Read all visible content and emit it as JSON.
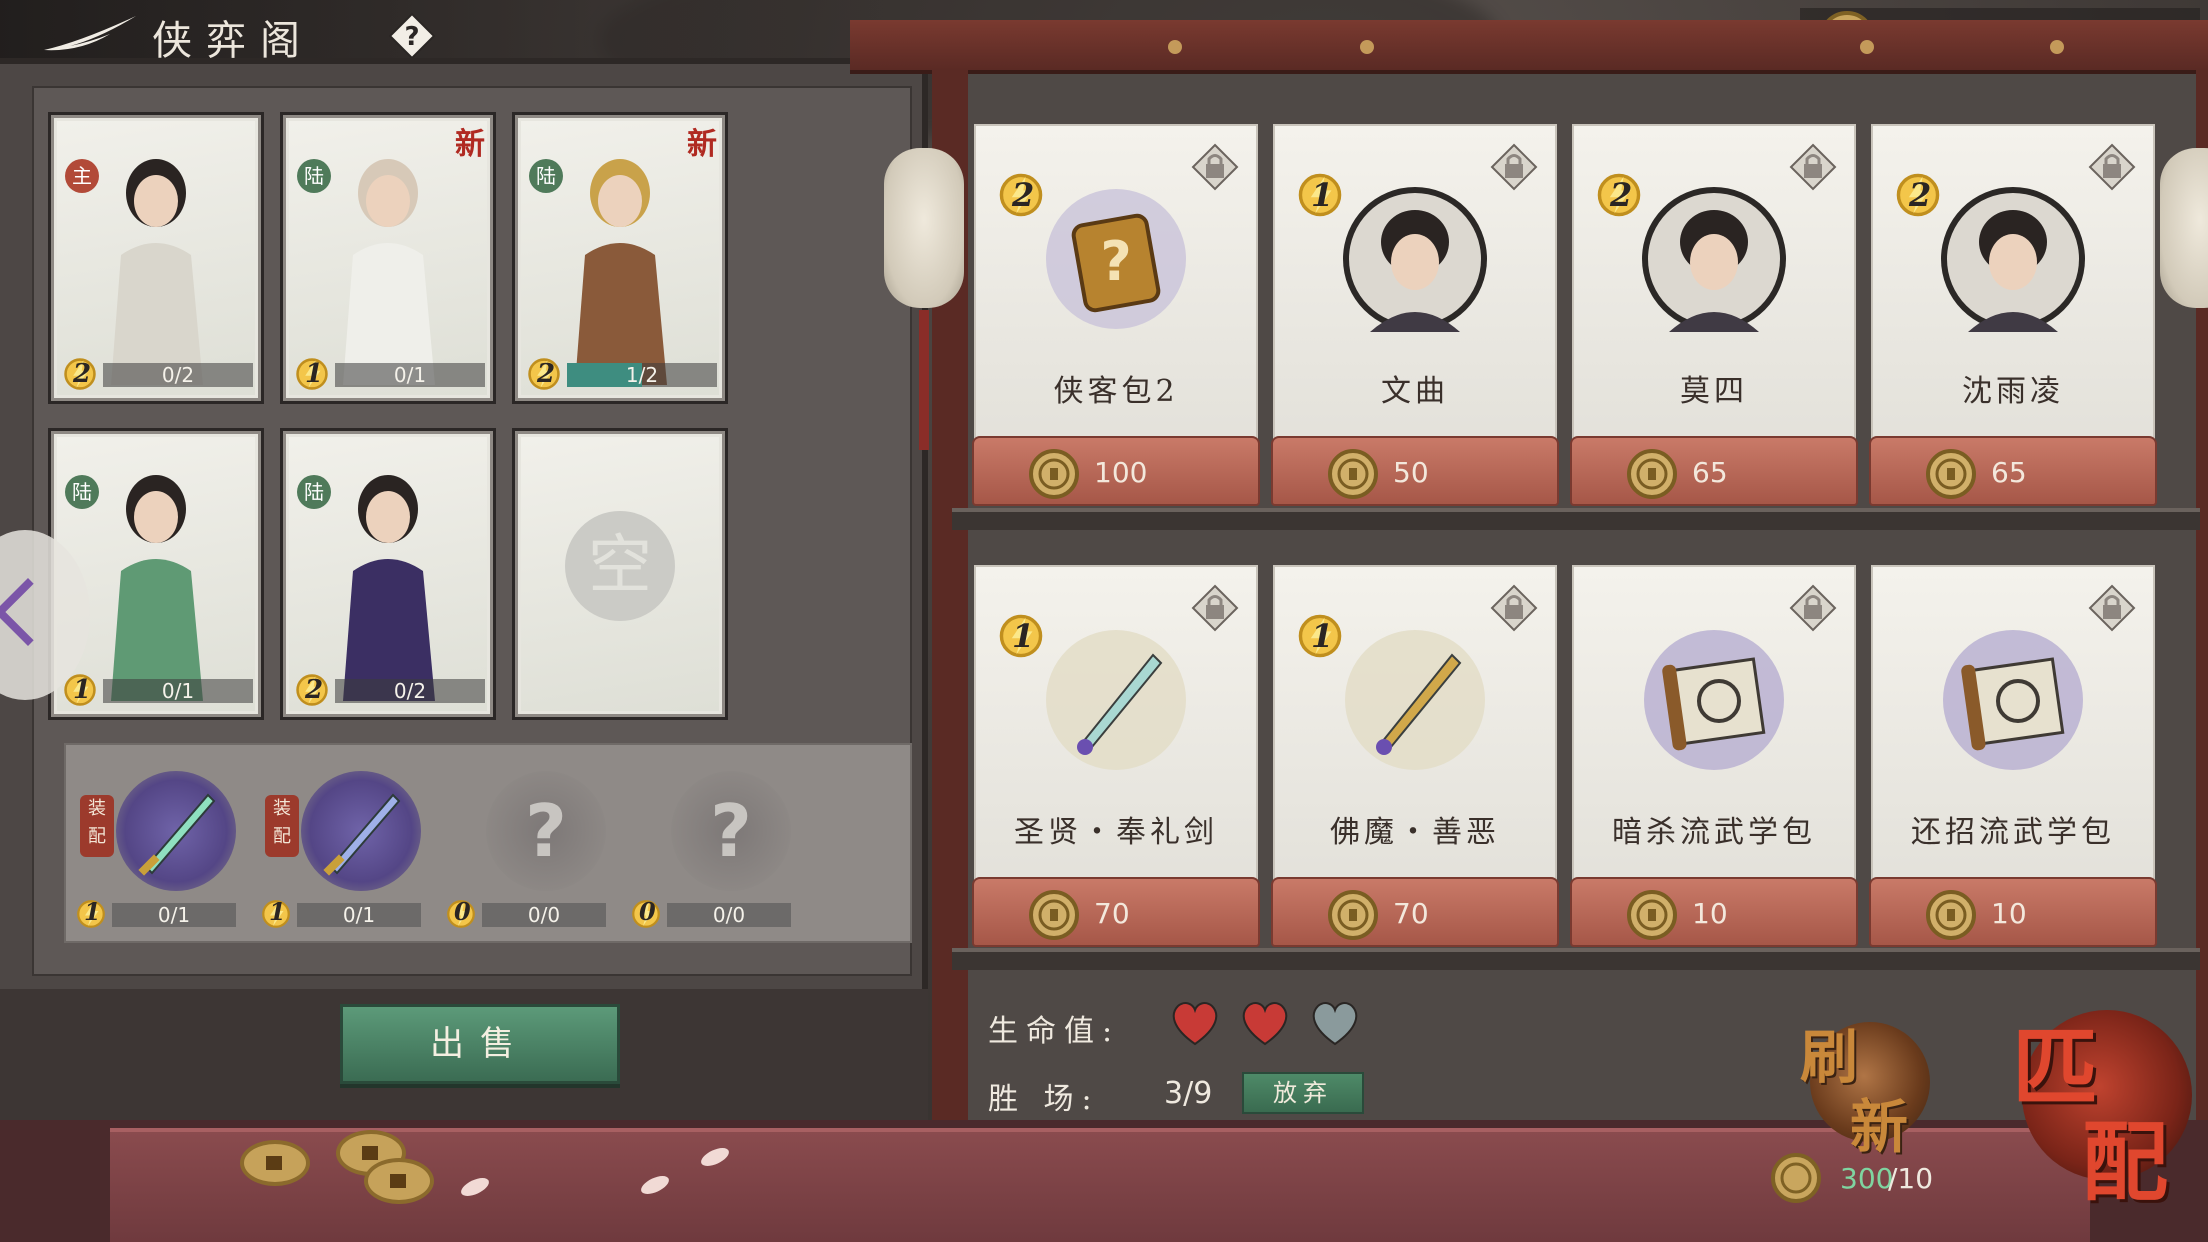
{
  "header": {
    "title": "侠弈阁",
    "help_label": "?"
  },
  "currency": {
    "coins": "300"
  },
  "roster": [
    {
      "cost": "2",
      "tag": "主",
      "tag_type": "lead",
      "progress": "0/2",
      "progress_fraction": 0,
      "is_new": false,
      "figure": "hero-swordsman"
    },
    {
      "cost": "1",
      "tag": "陆",
      "tag_type": "lu",
      "progress": "0/1",
      "progress_fraction": 0,
      "is_new": true,
      "new_label": "新",
      "figure": "hero-monk"
    },
    {
      "cost": "2",
      "tag": "陆",
      "tag_type": "lu",
      "progress": "1/2",
      "progress_fraction": 0.5,
      "is_new": true,
      "new_label": "新",
      "figure": "hero-curly-warrior"
    },
    {
      "cost": "1",
      "tag": "陆",
      "tag_type": "lu",
      "progress": "0/1",
      "progress_fraction": 0,
      "is_new": false,
      "figure": "hero-green-girl"
    },
    {
      "cost": "2",
      "tag": "陆",
      "tag_type": "lu",
      "progress": "0/2",
      "progress_fraction": 0,
      "is_new": false,
      "figure": "hero-purple-lady"
    },
    {
      "empty": true,
      "empty_label": "空"
    }
  ],
  "equipment": [
    {
      "cost": "1",
      "assembly_label": "装配",
      "progress": "0/1",
      "filled": true,
      "item": "green-sword-icon"
    },
    {
      "cost": "1",
      "assembly_label": "装配",
      "progress": "0/1",
      "filled": true,
      "item": "purple-sword-icon"
    },
    {
      "cost": "0",
      "progress": "0/0",
      "filled": false,
      "item": "question-icon"
    },
    {
      "cost": "0",
      "progress": "0/0",
      "filled": false,
      "item": "question-icon"
    }
  ],
  "sell_button": "出售",
  "shop": {
    "row1": [
      {
        "cost": "2",
        "name": "侠客包2",
        "price": "100",
        "art": "mystery-pack-icon"
      },
      {
        "cost": "1",
        "name": "文曲",
        "price": "50",
        "art": "portrait-wenqu"
      },
      {
        "cost": "2",
        "name": "莫四",
        "price": "65",
        "art": "portrait-mosi"
      },
      {
        "cost": "2",
        "name": "沈雨凌",
        "price": "65",
        "art": "portrait-shenyuling"
      }
    ],
    "row2": [
      {
        "cost": "1",
        "name": "圣贤・奉礼剑",
        "price": "70",
        "art": "holy-sword-icon"
      },
      {
        "cost": "1",
        "name": "佛魔・善恶",
        "price": "70",
        "art": "buddha-staff-icon"
      },
      {
        "cost": "",
        "name": "暗杀流武学包",
        "price": "10",
        "art": "assassin-scroll-icon"
      },
      {
        "cost": "",
        "name": "还招流武学包",
        "price": "10",
        "art": "counter-scroll-icon"
      }
    ]
  },
  "status": {
    "hp_label": "生命值:",
    "hearts": [
      {
        "state": "full",
        "color": "#c83a36"
      },
      {
        "state": "full",
        "color": "#c83a36"
      },
      {
        "state": "empty",
        "color": "#8a9a9c"
      }
    ],
    "wins_label": "胜  场:",
    "wins_value": "3/9",
    "give_up_label": "放弃"
  },
  "actions": {
    "refresh_glyph_1": "刷",
    "refresh_glyph_2": "新",
    "match_glyph_1": "匹",
    "match_glyph_2": "配",
    "coins_current": "300",
    "refresh_cost": "/10"
  },
  "colors": {
    "accent_green": "#3e8d80",
    "price_plate": "#b0604f",
    "heart_red": "#c83a36",
    "sell_green": "#4a8366",
    "match_red": "#c0432f"
  }
}
